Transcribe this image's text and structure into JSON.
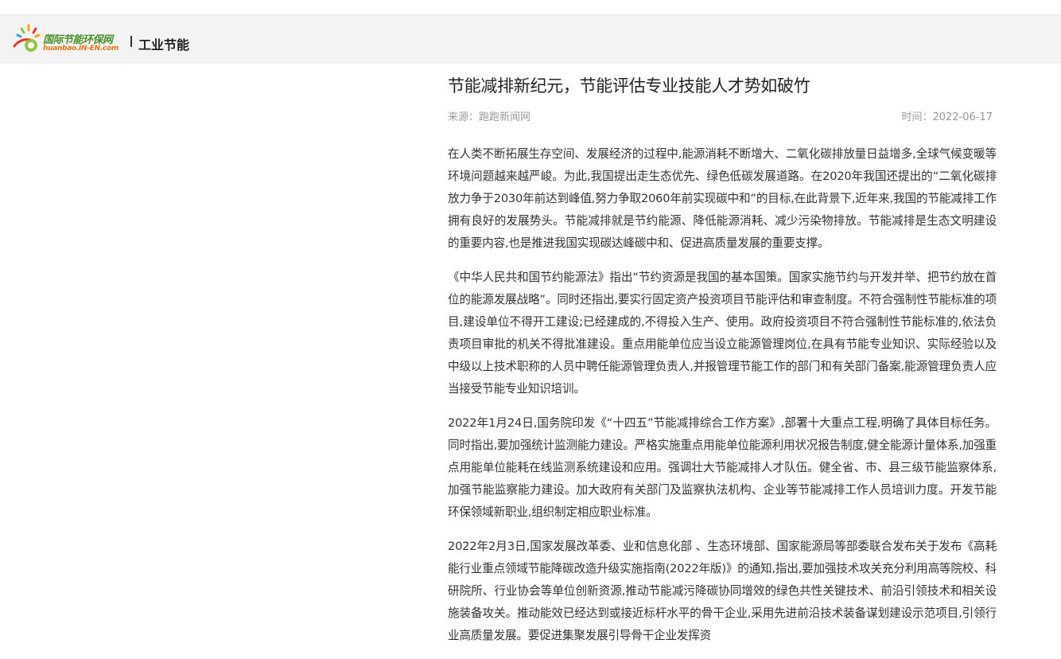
{
  "header": {
    "logo_text": "国际节能环保网",
    "logo_subtext": "huanbao.IN-EN.com",
    "section": "工业节能"
  },
  "article": {
    "title": "节能减排新纪元，节能评估专业技能人才势如破竹",
    "source": "来源：跑跑新闻网",
    "time": "时间：2022-06-17",
    "paragraphs": [
      "在人类不断拓展生存空间、发展经济的过程中,能源消耗不断增大、二氧化碳排放量日益增多,全球气候变暖等环境问题越来越严峻。为此,我国提出走生态优先、绿色低碳发展道路。在2020年我国还提出的“二氧化碳排放力争于2030年前达到峰值,努力争取2060年前实现碳中和”的目标,在此背景下,近年来,我国的节能减排工作拥有良好的发展势头。节能减排就是节约能源、降低能源消耗、减少污染物排放。节能减排是生态文明建设的重要内容,也是推进我国实现碳达峰碳中和、促进高质量发展的重要支撑。",
      "《中华人民共和国节约能源法》指出“节约资源是我国的基本国策。国家实施节约与开发并举、把节约放在首位的能源发展战略”。同时还指出,要实行固定资产投资项目节能评估和审查制度。不符合强制性节能标准的项目,建设单位不得开工建设;已经建成的,不得投入生产、使用。政府投资项目不符合强制性节能标准的,依法负责项目审批的机关不得批准建设。重点用能单位应当设立能源管理岗位,在具有节能专业知识、实际经验以及中级以上技术职称的人员中聘任能源管理负责人,并报管理节能工作的部门和有关部门备案,能源管理负责人应当接受节能专业知识培训。",
      "2022年1月24日,国务院印发《“十四五”节能减排综合工作方案》,部署十大重点工程,明确了具体目标任务。同时指出,要加强统计监测能力建设。严格实施重点用能单位能源利用状况报告制度,健全能源计量体系,加强重点用能单位能耗在线监测系统建设和应用。强调壮大节能减排人才队伍。健全省、市、县三级节能监察体系,加强节能监察能力建设。加大政府有关部门及监察执法机构、企业等节能减排工作人员培训力度。开发节能环保领域新职业,组织制定相应职业标准。",
      "2022年2月3日,国家发展改革委、业和信息化部 、生态环境部、国家能源局等部委联合发布关于发布《高耗能行业重点领域节能降碳改造升级实施指南(2022年版)》的通知,指出,要加强技术攻关充分利用高等院校、科研院所、行业协会等单位创新资源,推动节能减污降碳协同增效的绿色共性关键技术、前沿引领技术和相关设施装备攻关。推动能效已经达到或接近标杆水平的骨干企业,采用先进前沿技术装备谋划建设示范项目,引领行业高质量发展。要促进集聚发展引导骨干企业发挥资"
    ]
  }
}
